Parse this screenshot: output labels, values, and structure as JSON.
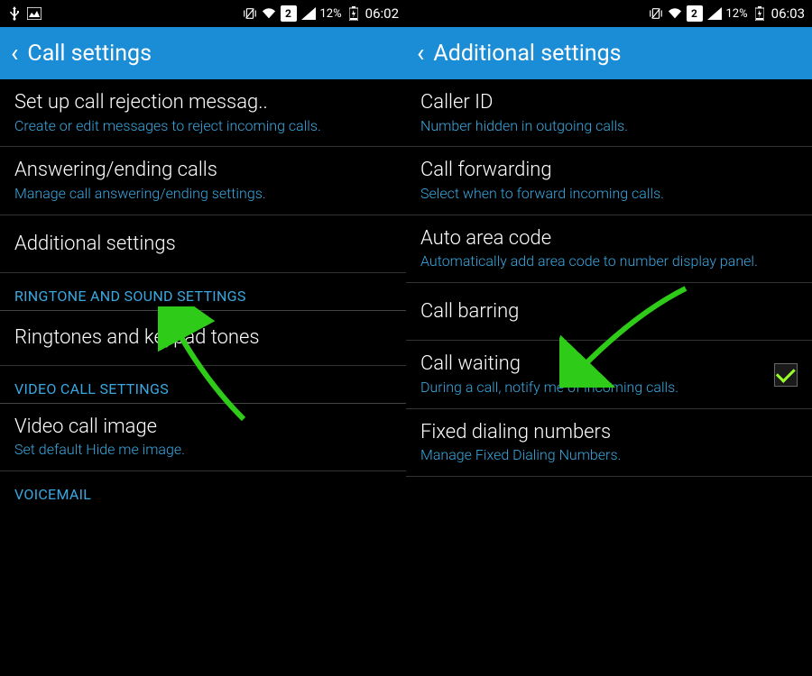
{
  "left": {
    "status": {
      "battery": "12%",
      "time": "06:02",
      "sim": "2"
    },
    "header": {
      "title": "Call settings"
    },
    "items": [
      {
        "title": "Set up call rejection messag..",
        "subtitle": "Create or edit messages to reject incoming calls."
      },
      {
        "title": "Answering/ending calls",
        "subtitle": "Manage call answering/ending settings."
      },
      {
        "title": "Additional settings",
        "subtitle": ""
      }
    ],
    "sections": [
      {
        "header": "RINGTONE AND SOUND SETTINGS",
        "items": [
          {
            "title": "Ringtones and keypad tones",
            "subtitle": ""
          }
        ]
      },
      {
        "header": "VIDEO CALL SETTINGS",
        "items": [
          {
            "title": "Video call image",
            "subtitle": "Set default Hide me image."
          }
        ]
      },
      {
        "header": "VOICEMAIL",
        "items": []
      }
    ]
  },
  "right": {
    "status": {
      "battery": "12%",
      "time": "06:03",
      "sim": "2"
    },
    "header": {
      "title": "Additional settings"
    },
    "items": [
      {
        "title": "Caller ID",
        "subtitle": "Number hidden in outgoing calls."
      },
      {
        "title": "Call forwarding",
        "subtitle": "Select when to forward incoming calls."
      },
      {
        "title": "Auto area code",
        "subtitle": "Automatically add area code to number display panel."
      },
      {
        "title": "Call barring",
        "subtitle": ""
      },
      {
        "title": "Call waiting",
        "subtitle": "During a call, notify me of incoming calls.",
        "checkbox": true,
        "checked": true
      },
      {
        "title": "Fixed dialing numbers",
        "subtitle": "Manage Fixed Dialing Numbers."
      }
    ]
  }
}
